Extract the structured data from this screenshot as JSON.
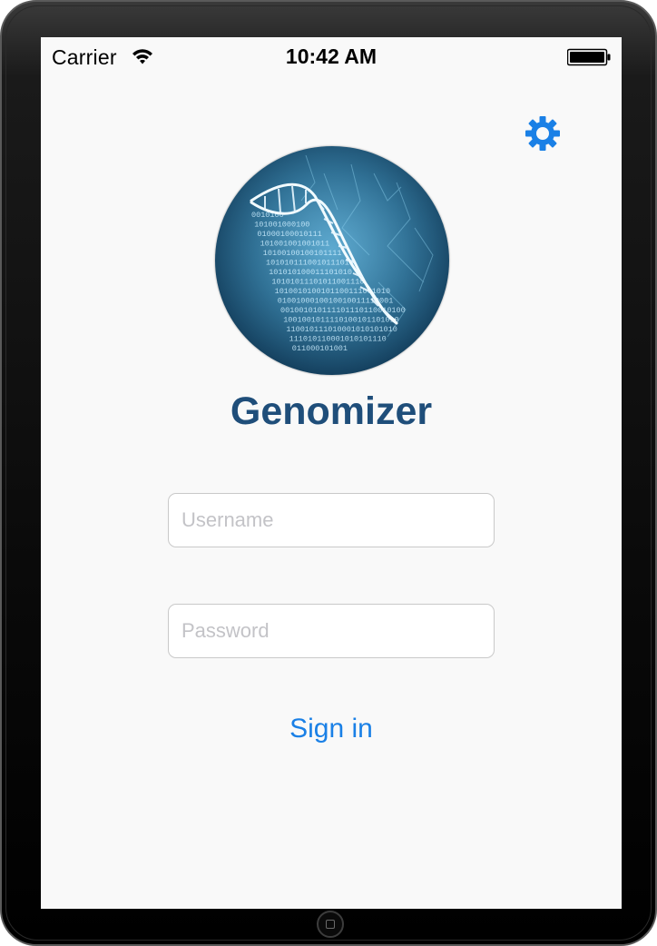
{
  "status_bar": {
    "carrier": "Carrier",
    "time": "10:42 AM",
    "wifi_icon": "wifi-icon",
    "battery_icon": "battery-icon"
  },
  "settings": {
    "icon": "gear-icon",
    "color": "#1a80e6"
  },
  "app": {
    "title": "Genomizer",
    "title_color": "#1f4e7a",
    "logo": "dna-helix-logo"
  },
  "login": {
    "username_placeholder": "Username",
    "username_value": "",
    "password_placeholder": "Password",
    "password_value": "",
    "sign_in_label": "Sign in",
    "accent": "#1a80e6"
  },
  "logo_binary_lines": [
    "0010100",
    "101001000100",
    "01000100010111",
    "101001001001011",
    "10100100100101111",
    "1010101110010111010",
    "101010100011101010",
    "10101011101011001110",
    "1010010100101100111001010",
    "0100100010010010011110001",
    "001001010111101110110010100",
    "1001001011110100101101010",
    "110010111010001010101010",
    "111010110001010101110",
    "011000101001"
  ]
}
